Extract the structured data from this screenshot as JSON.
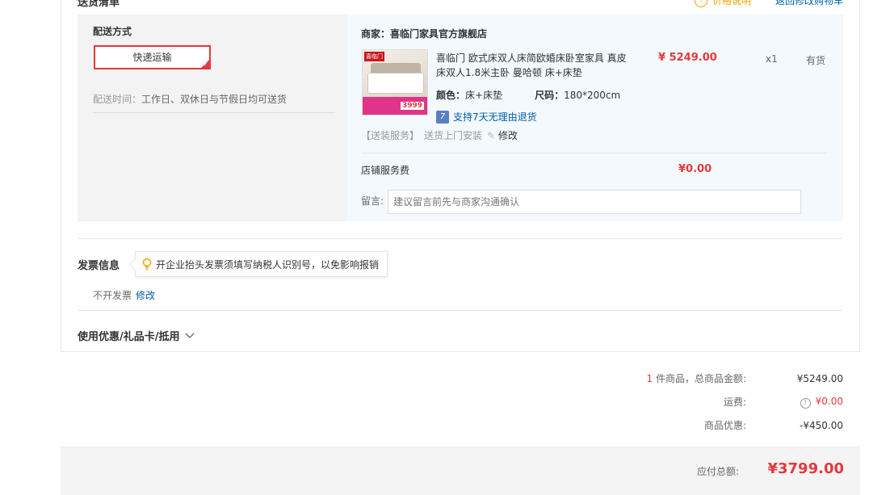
{
  "header": {
    "section_title": "送货清单",
    "price_notice": "价格说明",
    "back_to_cart": "返回修改购物车"
  },
  "shipping": {
    "title": "配送方式",
    "method": "快递运输",
    "time_label": "配送时间：",
    "time_value": "工作日、双休日与节假日均可送货"
  },
  "shop": {
    "merchant_label": "商家：",
    "merchant_name": "喜临门家具官方旗舰店",
    "product": {
      "image_brand": "喜临门",
      "image_price": "3999",
      "title": "喜临门 欧式床双人床简欧婚床卧室家具 真皮床双人1.8米主卧 曼哈顿 床+床垫",
      "price": "¥ 5249.00",
      "qty": "x1",
      "stock": "有货",
      "color_label": "颜色：",
      "color_value": "床+床垫",
      "size_label": "尺码：",
      "size_value": "180*200cm",
      "return_icon": "7",
      "return_text": "支持7天无理由退货"
    },
    "install_tag": "【送装服务】",
    "install_text": "送货上门安装",
    "install_edit": "修改",
    "service_fee_label": "店铺服务费",
    "service_fee_value": "¥0.00",
    "note_label": "留言:",
    "note_placeholder": "建议留言前先与商家沟通确认"
  },
  "invoice": {
    "title": "发票信息",
    "tip": "开企业抬头发票须填写纳税人识别号，以免影响报销",
    "status": "不开发票",
    "edit": "修改"
  },
  "coupon": {
    "title": "使用优惠/礼品卡/抵用"
  },
  "summary": {
    "count": "1",
    "count_label": "件商品，总商品金额:",
    "goods_total": "¥5249.00",
    "shipping_label": "运费:",
    "shipping_value": "¥0.00",
    "discount_label": "商品优惠:",
    "discount_value": "-¥450.00",
    "payable_label": "应付总额:",
    "payable_value": "¥3799.00"
  },
  "colors": {
    "accent_red": "#e4393c",
    "link_blue": "#005ea7",
    "shop_bg": "#f3f9fd",
    "ship_bg": "#f3f3f3"
  }
}
